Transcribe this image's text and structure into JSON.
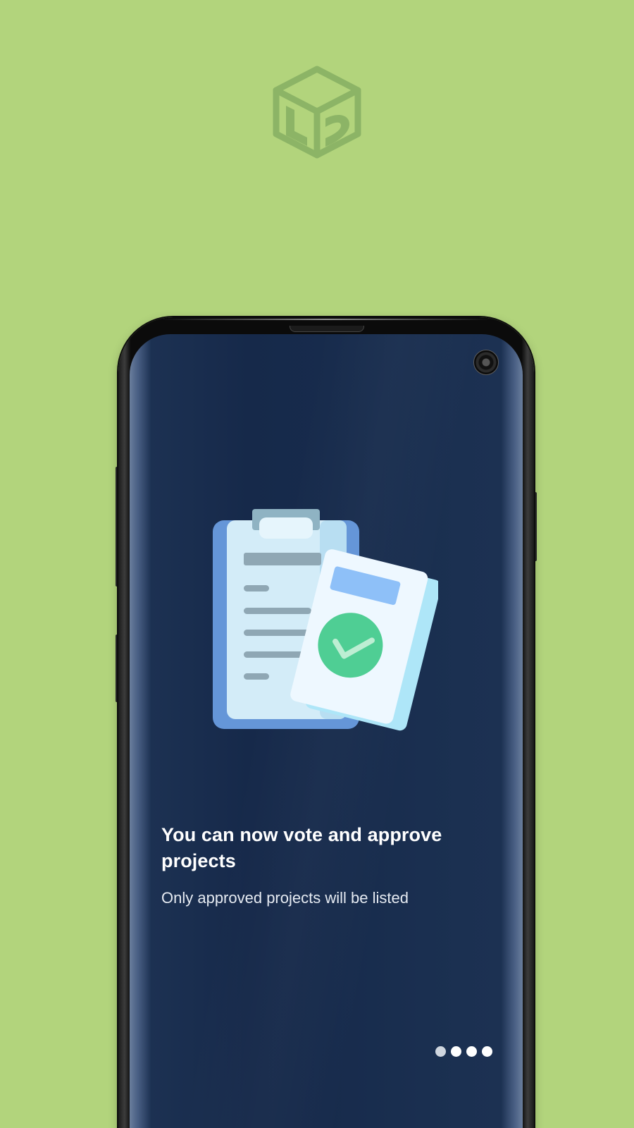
{
  "background_color": "#b2d47c",
  "brand": {
    "logo_icon": "cube-logo-icon",
    "logo_color": "#8cb466"
  },
  "device": {
    "camera_icon": "front-camera-icon"
  },
  "onboarding": {
    "illustration_icon": "approved-clipboard-illustration",
    "title": "You can now vote and approve projects",
    "subtitle": "Only approved projects will be listed",
    "screen_color": "#172b4c",
    "pager": {
      "total": 4,
      "current": 1,
      "indicator_icons": [
        "page-dot-icon",
        "page-dot-icon",
        "page-dot-icon",
        "page-dot-icon"
      ]
    }
  }
}
